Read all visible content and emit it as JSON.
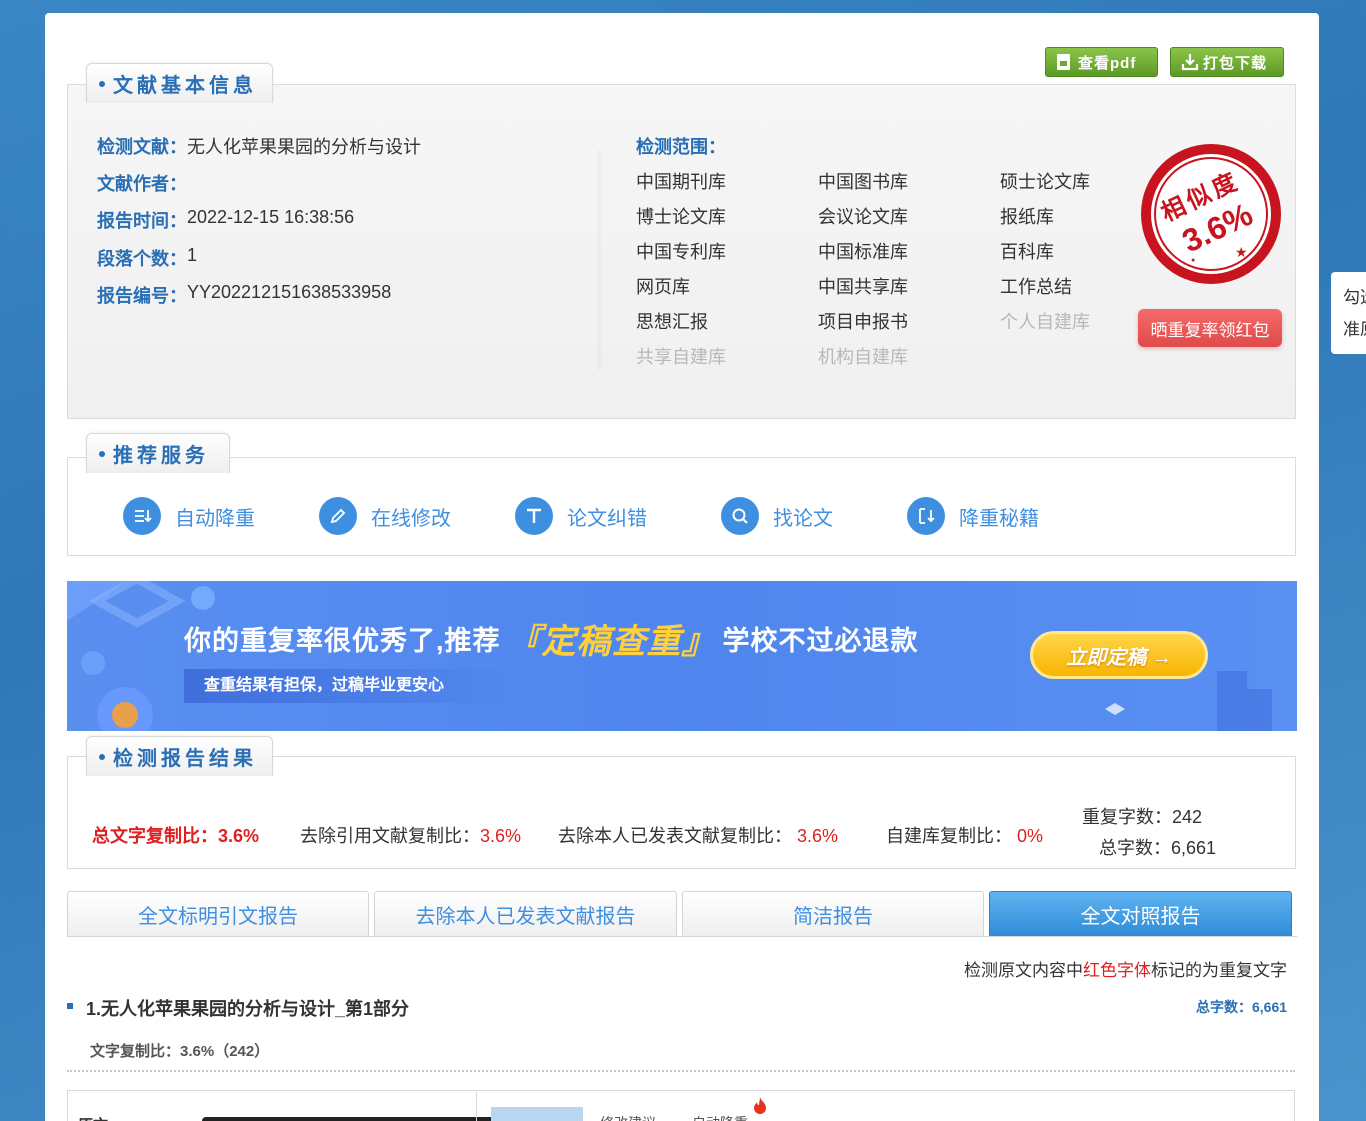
{
  "top_buttons": {
    "view_pdf": "查看pdf",
    "download": "打包下载"
  },
  "side_tip": {
    "line1": "勾选",
    "line2": "准原"
  },
  "basic_info": {
    "section_title": "文献基本信息",
    "rows": [
      {
        "key": "检测文献：",
        "value": "无人化苹果果园的分析与设计"
      },
      {
        "key": "文献作者：",
        "value": ""
      },
      {
        "key": "报告时间：",
        "value": "2022-12-15 16:38:56"
      },
      {
        "key": "段落个数：",
        "value": "1"
      },
      {
        "key": "报告编号：",
        "value": "YY202212151638533958"
      }
    ],
    "scope_title": "检测范围：",
    "databases": [
      {
        "name": "中国期刊库",
        "enabled": true
      },
      {
        "name": "中国图书库",
        "enabled": true
      },
      {
        "name": "硕士论文库",
        "enabled": true
      },
      {
        "name": "博士论文库",
        "enabled": true
      },
      {
        "name": "会议论文库",
        "enabled": true
      },
      {
        "name": "报纸库",
        "enabled": true
      },
      {
        "name": "中国专利库",
        "enabled": true
      },
      {
        "name": "中国标准库",
        "enabled": true
      },
      {
        "name": "百科库",
        "enabled": true
      },
      {
        "name": "网页库",
        "enabled": true
      },
      {
        "name": "中国共享库",
        "enabled": true
      },
      {
        "name": "工作总结",
        "enabled": true
      },
      {
        "name": "思想汇报",
        "enabled": true
      },
      {
        "name": "项目申报书",
        "enabled": true
      },
      {
        "name": "个人自建库",
        "enabled": false
      },
      {
        "name": "共享自建库",
        "enabled": false
      },
      {
        "name": "机构自建库",
        "enabled": false
      }
    ],
    "stamp": {
      "label": "相似度",
      "value": "3.6%"
    },
    "share_button": "晒重复率领红包"
  },
  "services": {
    "section_title": "推荐服务",
    "items": [
      {
        "label": "自动降重",
        "icon": "reduce-icon"
      },
      {
        "label": "在线修改",
        "icon": "pencil-icon"
      },
      {
        "label": "论文纠错",
        "icon": "text-t-icon"
      },
      {
        "label": "找论文",
        "icon": "search-icon"
      },
      {
        "label": "降重秘籍",
        "icon": "reduce-icon"
      }
    ]
  },
  "banner": {
    "headline_pre": "你的重复率很优秀了,推荐",
    "headline_hl": "『定稿查重』",
    "headline_post": "学校不过必退款",
    "subline": "查重结果有担保，过稿毕业更安心",
    "cta": "立即定稿 →"
  },
  "results": {
    "section_title": "检测报告结果",
    "total_label": "总文字复制比：",
    "total_value": "3.6%",
    "excl_cite_label": "去除引用文献复制比：",
    "excl_cite_value": "3.6%",
    "excl_self_label": "去除本人已发表文献复制比：",
    "excl_self_value": "3.6%",
    "self_built_label": "自建库复制比：",
    "self_built_value": "0%",
    "dup_words_label": "重复字数：",
    "dup_words_value": "242",
    "total_words_label": "总字数：",
    "total_words_value": "6,661"
  },
  "report_tabs": [
    {
      "label": "全文标明引文报告",
      "active": false
    },
    {
      "label": "去除本人已发表文献报告",
      "active": false
    },
    {
      "label": "简洁报告",
      "active": false
    },
    {
      "label": "全文对照报告",
      "active": true
    }
  ],
  "legend": {
    "pre": "检测原文内容中",
    "red": "红色字体",
    "post": "标记的为重复文字"
  },
  "part": {
    "title": "1.无人化苹果果园的分析与设计_第1部分",
    "total_words": "总字数：6,661",
    "ratio": "文字复制比：3.6%（242）"
  },
  "bottom_bar": {
    "left_label": "原文",
    "tab1": "修改建议",
    "tab2": "自动降重"
  },
  "colors": {
    "brand_blue": "#2a6fb5",
    "accent_blue": "#3f8fe0",
    "red": "#e02020",
    "green": "#6aaa30"
  }
}
